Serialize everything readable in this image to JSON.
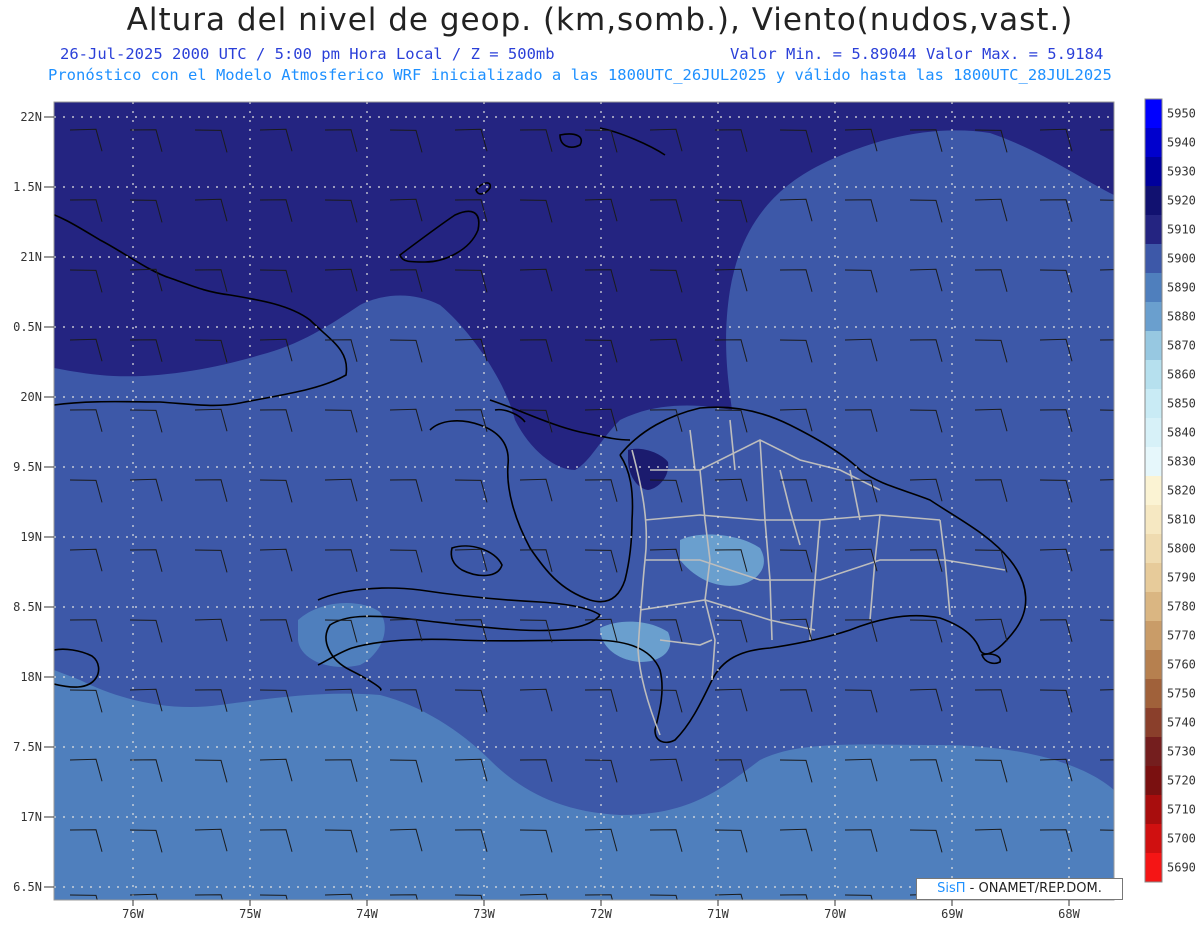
{
  "header": {
    "title": "Altura del nivel de geop. (km,somb.), Viento(nudos,vast.)",
    "subtitle_left": "26-Jul-2025   2000 UTC / 5:00 pm Hora Local / Z = 500mb",
    "subtitle_right": "Valor Min. = 5.89044   Valor Max. = 5.9184",
    "subtitle2": "Pronóstico con el Modelo Atmosferico WRF inicializado a las 1800UTC_26JUL2025 y válido hasta las  1800UTC_28JUL2025"
  },
  "axes": {
    "lat_labels": [
      "22N",
      "1.5N",
      "21N",
      "0.5N",
      "20N",
      "9.5N",
      "19N",
      "8.5N",
      "18N",
      "7.5N",
      "17N",
      "6.5N"
    ],
    "lon_labels": [
      "76W",
      "75W",
      "74W",
      "73W",
      "72W",
      "71W",
      "70W",
      "69W",
      "68W"
    ]
  },
  "colorbar": {
    "labels": [
      "5950",
      "5940",
      "5930",
      "5920",
      "5910",
      "5900",
      "5890",
      "5880",
      "5870",
      "5860",
      "5850",
      "5840",
      "5830",
      "5820",
      "5810",
      "5800",
      "5790",
      "5780",
      "5770",
      "5760",
      "5750",
      "5740",
      "5730",
      "5720",
      "5710",
      "5700",
      "5690"
    ],
    "colors": [
      "#0000ff",
      "#0000cd",
      "#00009c",
      "#111170",
      "#242481",
      "#3d58a8",
      "#4f7fbd",
      "#6a9fce",
      "#97c8e1",
      "#b6e0ee",
      "#c9ebf5",
      "#d7f1f8",
      "#e6f7fb",
      "#fbf3d3",
      "#f6e8c2",
      "#efdbb0",
      "#e7cb9a",
      "#dab682",
      "#c99c68",
      "#b6804f",
      "#a0613a",
      "#8a3f2b",
      "#741e1e",
      "#7a1010",
      "#a80d0d",
      "#d01010",
      "#f51515"
    ]
  },
  "credit": {
    "brand": "SisΠ",
    "text": " -  ONAMET/REP.DOM."
  }
}
